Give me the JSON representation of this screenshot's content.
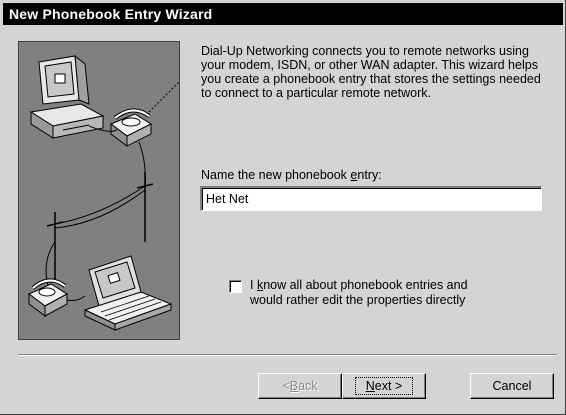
{
  "window": {
    "title": "New Phonebook Entry Wizard"
  },
  "illustration": {
    "description_icon": "dialup-network-illustration"
  },
  "intro": {
    "text": "Dial-Up Networking connects you to remote networks using your modem, ISDN, or other WAN adapter.  This wizard helps you create a phonebook entry that stores the settings needed to connect to a particular remote network."
  },
  "entry_field": {
    "label_prefix": "Name the new phonebook ",
    "label_accel": "e",
    "label_suffix": "ntry:",
    "value": "Het Net"
  },
  "expert_checkbox": {
    "checked": false,
    "label_line1_prefix": "I ",
    "label_line1_accel": "k",
    "label_line1_suffix": "now all about phonebook entries and",
    "label_line2": "would rather edit the properties directly"
  },
  "buttons": {
    "back_prefix": "< ",
    "back_accel": "B",
    "back_suffix": "ack",
    "back_enabled": false,
    "next_accel": "N",
    "next_suffix": "ext >",
    "cancel": "Cancel"
  },
  "colors": {
    "title_bar": "#000000",
    "dialog_face": "#d4d4d4",
    "illustration_bg": "#808080"
  }
}
